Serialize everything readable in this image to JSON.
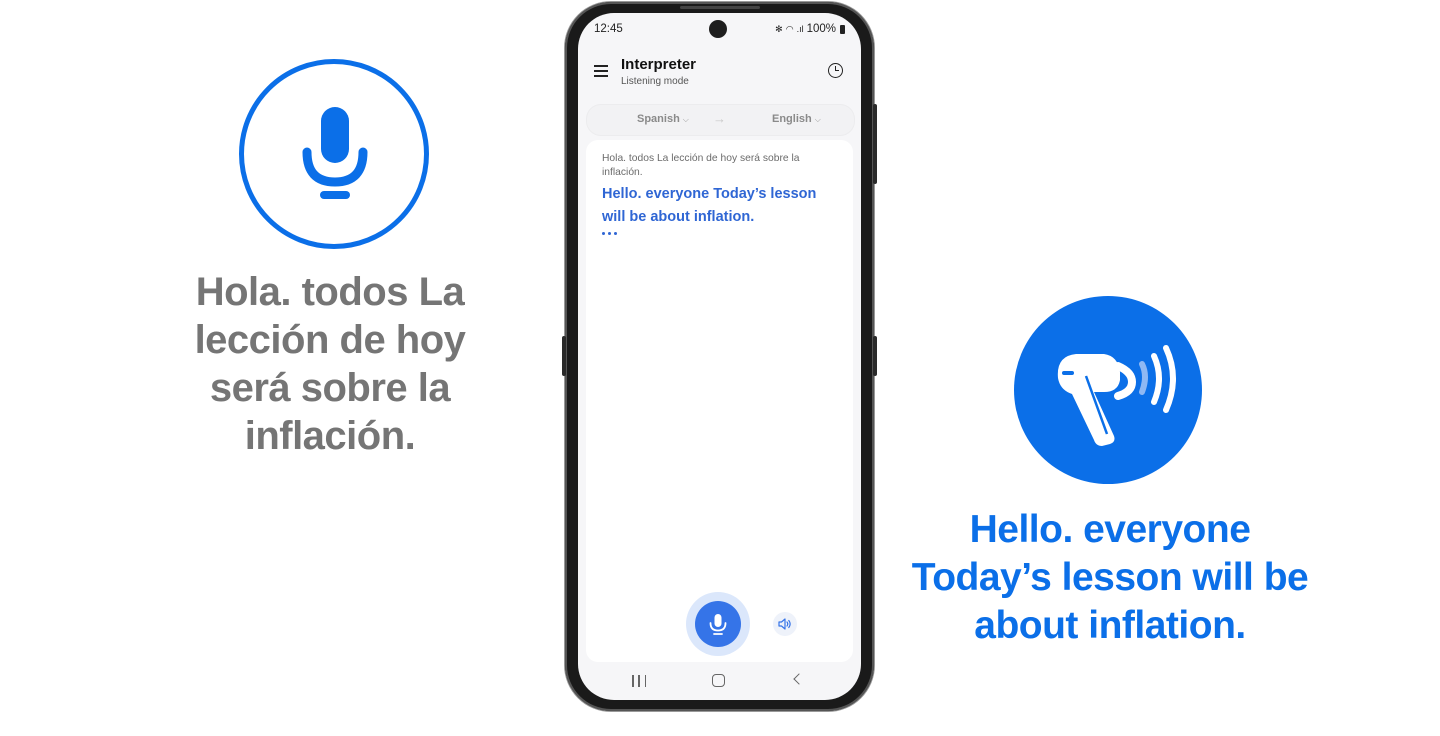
{
  "left_panel": {
    "icon": "microphone-icon",
    "text": "Hola. todos La lección de hoy será sobre la inflación.",
    "color": "#757575"
  },
  "right_panel": {
    "icon": "earbud-sound-icon",
    "text": "Hello. everyone Today’s lesson will be about inflation.",
    "color": "#0b6fe8"
  },
  "phone": {
    "status_bar": {
      "time": "12:45",
      "icons": [
        "bluetooth-icon",
        "wifi-icon",
        "signal-icon"
      ],
      "battery": "100%"
    },
    "app_bar": {
      "title": "Interpreter",
      "subtitle": "Listening mode",
      "menu_icon": "hamburger-menu-icon",
      "history_icon": "history-clock-icon"
    },
    "language_bar": {
      "source": "Spanish",
      "target": "English",
      "arrow_icon": "arrow-right-icon"
    },
    "transcript": {
      "source_text": "Hola. todos La lección de hoy será sobre la inflación.",
      "translated_text": "Hello. everyone Today’s lesson will be about inflation.",
      "typing_indicator": "..."
    },
    "controls": {
      "mic_button": "microphone-icon",
      "speaker_button": "speaker-icon"
    },
    "nav_bar": {
      "items": [
        "recents",
        "home",
        "back"
      ]
    },
    "accent_color": "#3574e8",
    "translation_color": "#2f66d4"
  }
}
